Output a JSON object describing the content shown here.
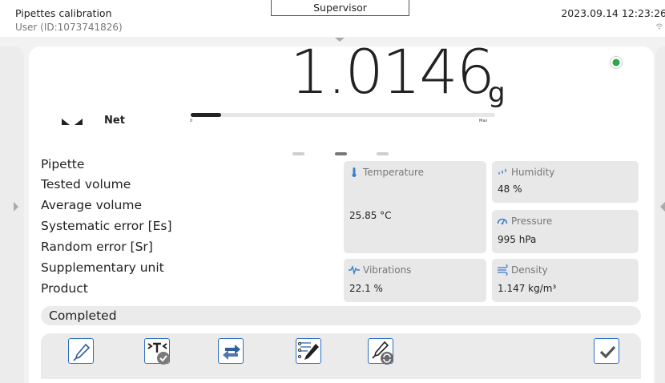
{
  "header": {
    "app_title": "Pipettes calibration",
    "user": "User (ID:1073741826)",
    "role": "Supervisor",
    "datetime": "2023.09.14 12:23:26"
  },
  "weighing": {
    "value": "1.0146",
    "unit": "g",
    "mode_label": "Net",
    "range_min": "0",
    "range_max": "Max",
    "range_fill_fraction": 0.1,
    "stability_color": "#2aa84a"
  },
  "params": [
    "Pipette",
    "Tested volume",
    "Average volume",
    "Systematic error [Es]",
    "Random error [Sr]",
    "Supplementary unit",
    "Product"
  ],
  "ambient": {
    "temperature": {
      "label": "Temperature",
      "value": "25.85 °C"
    },
    "humidity": {
      "label": "Humidity",
      "value": "48 %"
    },
    "pressure": {
      "label": "Pressure",
      "value": "995 hPa"
    },
    "vibrations": {
      "label": "Vibrations",
      "value": "22.1 %"
    },
    "density": {
      "label": "Density",
      "value": "1.147 kg/m³"
    }
  },
  "status": "Completed",
  "toolbar": {
    "buttons": [
      "pipette-icon",
      "tare-confirm-icon",
      "transfer-icon",
      "report-edit-icon",
      "pipette-refresh-icon",
      "confirm-icon"
    ]
  },
  "colors": {
    "accent": "#2c6fc2",
    "icon_blue": "#2f5f9e",
    "ambient_icon": "#3b7fd0"
  }
}
